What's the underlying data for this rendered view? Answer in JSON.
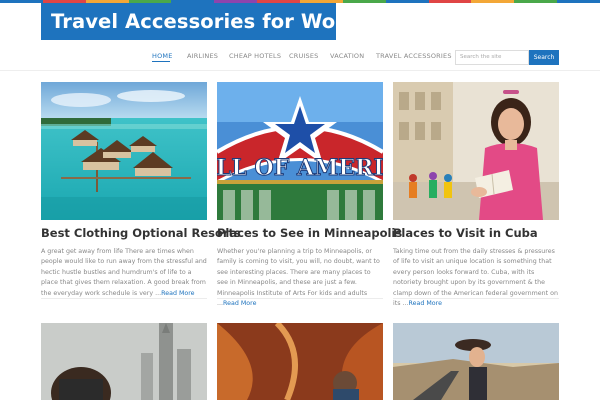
{
  "site": {
    "title": "Travel Accessories for Women"
  },
  "colors": {
    "accent": "#1e73be",
    "rainbow": [
      "#1e73be",
      "#e04545",
      "#f3a737",
      "#4aa84a",
      "#1e73be",
      "#8e44ad",
      "#e04545",
      "#f3a737",
      "#4aa84a",
      "#1e73be",
      "#e04545",
      "#f3a737",
      "#4aa84a",
      "#1e73be"
    ]
  },
  "nav": {
    "items": [
      {
        "label": "Home",
        "active": true
      },
      {
        "label": "Airlines"
      },
      {
        "label": "Cheap Hotels"
      },
      {
        "label": "Cruises"
      },
      {
        "label": "Vacation"
      },
      {
        "label": "Travel Accessories"
      }
    ]
  },
  "search": {
    "placeholder": "Search the site",
    "button_label": "Search"
  },
  "posts": [
    {
      "title": "Best Clothing Optional Resorts",
      "excerpt": "A great get away from life There are times when people would like to run away from the stressful and hectic hustle bustles and humdrum's of life to a place that gives them relaxation. A good break from the everyday work schedule is very ...",
      "read_more": "Read More",
      "image": "overwater-bungalows-photo"
    },
    {
      "title": "Places to See in Minneapolis",
      "excerpt": "Whether you're planning a trip to Minneapolis, or family is coming to visit, you will, no doubt, want to see interesting places. There are many places to see in Minneapolis, and these are just a few. Minneapolis Institute of Arts For kids and adults ...",
      "read_more": "Read More",
      "image": "mall-of-america-sign-photo",
      "sign_text": "ALL OF AMERIC"
    },
    {
      "title": "Places to Visit in Cuba",
      "excerpt": "Taking time out from the daily stresses & pressures of life to visit an unique location is something that every person looks forward to. Cuba, with its notoriety brought upon by its government & the clamp down of the American federal government on its ...",
      "read_more": "Read More",
      "image": "woman-with-map-in-havana-photo"
    }
  ],
  "bottom_posts": [
    {
      "image": "city-skyline-photographer-photo"
    },
    {
      "image": "canyon-hiker-photo"
    },
    {
      "image": "woman-on-road-photo"
    }
  ]
}
